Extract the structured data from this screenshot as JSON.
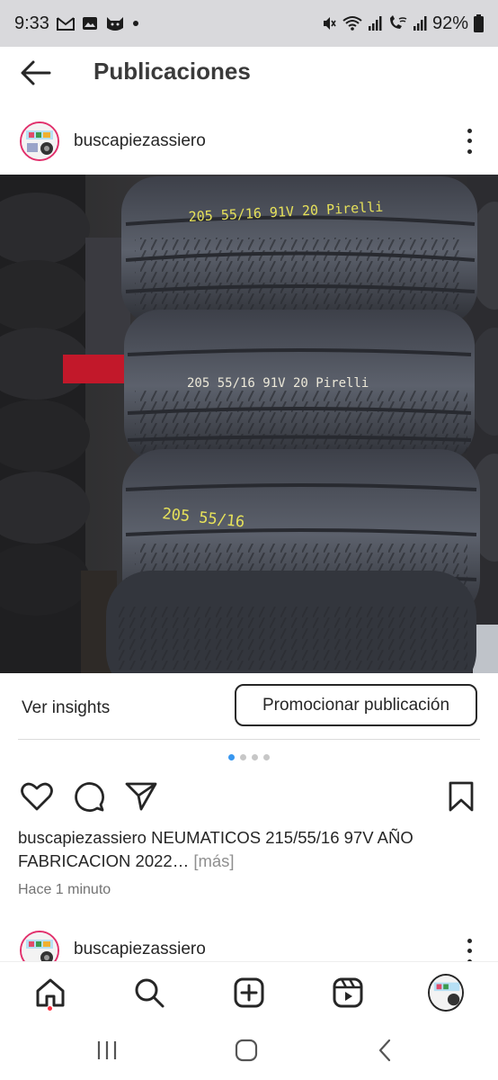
{
  "status_bar": {
    "time": "9:33",
    "left_icons": [
      "gmail-icon",
      "photo-icon",
      "cat-app-icon",
      "notification-dot-icon"
    ],
    "right_icons": [
      "mute-icon",
      "wifi-icon",
      "signal-icon",
      "wifi-calling-icon",
      "signal-2-icon",
      "battery-icon"
    ],
    "battery": "92%"
  },
  "header": {
    "title": "Publicaciones",
    "back_icon": "arrow-left-icon"
  },
  "post": {
    "username": "buscapiezassiero",
    "more_icon": "more-vertical-icon",
    "image_alt": "Stack of used tires",
    "tire_labels": [
      "205 55/16 91V 20 Pirelli",
      "205 55/16 91V 20 Pirelli",
      "205 55/16"
    ],
    "insights_label": "Ver insights",
    "promote_label": "Promocionar publicación",
    "carousel": {
      "count": 4,
      "active": 0
    },
    "caption_user": "buscapiezassiero",
    "caption_text": "NEUMATICOS 215/55/16 97V AÑO FABRICACION 2022…",
    "caption_more": "[más]",
    "time_ago": "Hace 1 minuto"
  },
  "next_post": {
    "username": "buscapiezassiero"
  },
  "bottom_nav": {
    "items": [
      "home-icon",
      "search-icon",
      "create-icon",
      "reels-icon",
      "profile-avatar"
    ]
  },
  "system_nav": {
    "items": [
      "recents-icon",
      "home-circle-icon",
      "back-chevron-icon"
    ]
  },
  "colors": {
    "accent": "#3897f0",
    "text": "#262626",
    "muted": "#737373",
    "notification": "#ff3040"
  }
}
